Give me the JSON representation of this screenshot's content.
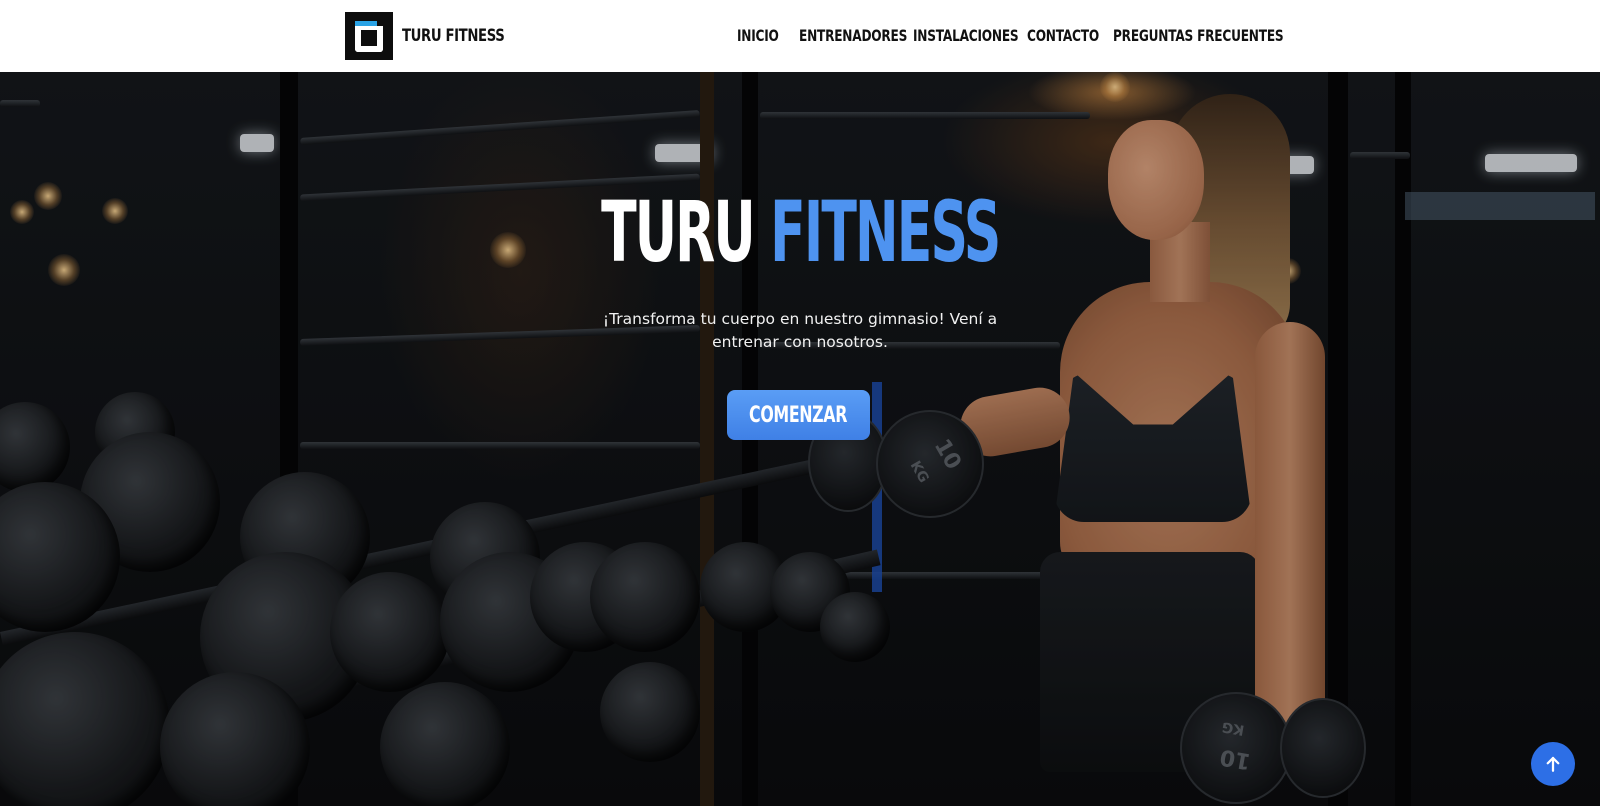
{
  "brand": {
    "name": "TURU FITNESS",
    "logo_icon": "turu-u-logo-icon",
    "colors": {
      "accent": "#4e93f0",
      "logo_bar": "#2aa3e6",
      "nav_bg": "#ffffff"
    }
  },
  "nav": {
    "items": [
      {
        "label": "INICIO"
      },
      {
        "label": "ENTRENADORES"
      },
      {
        "label": "INSTALACIONES"
      },
      {
        "label": "CONTACTO"
      },
      {
        "label": "PREGUNTAS FRECUENTES"
      }
    ]
  },
  "hero": {
    "title_white": "TURU",
    "title_blue": "FITNESS",
    "subtitle": "¡Transforma tu cuerpo en nuestro gimnasio! Vení a entrenar con nosotros.",
    "cta_label": "COMENZAR",
    "image_labels": {
      "dumbbell_weight": "10",
      "dumbbell_unit": "KG"
    }
  },
  "scroll_top": {
    "icon": "arrow-up-icon"
  }
}
